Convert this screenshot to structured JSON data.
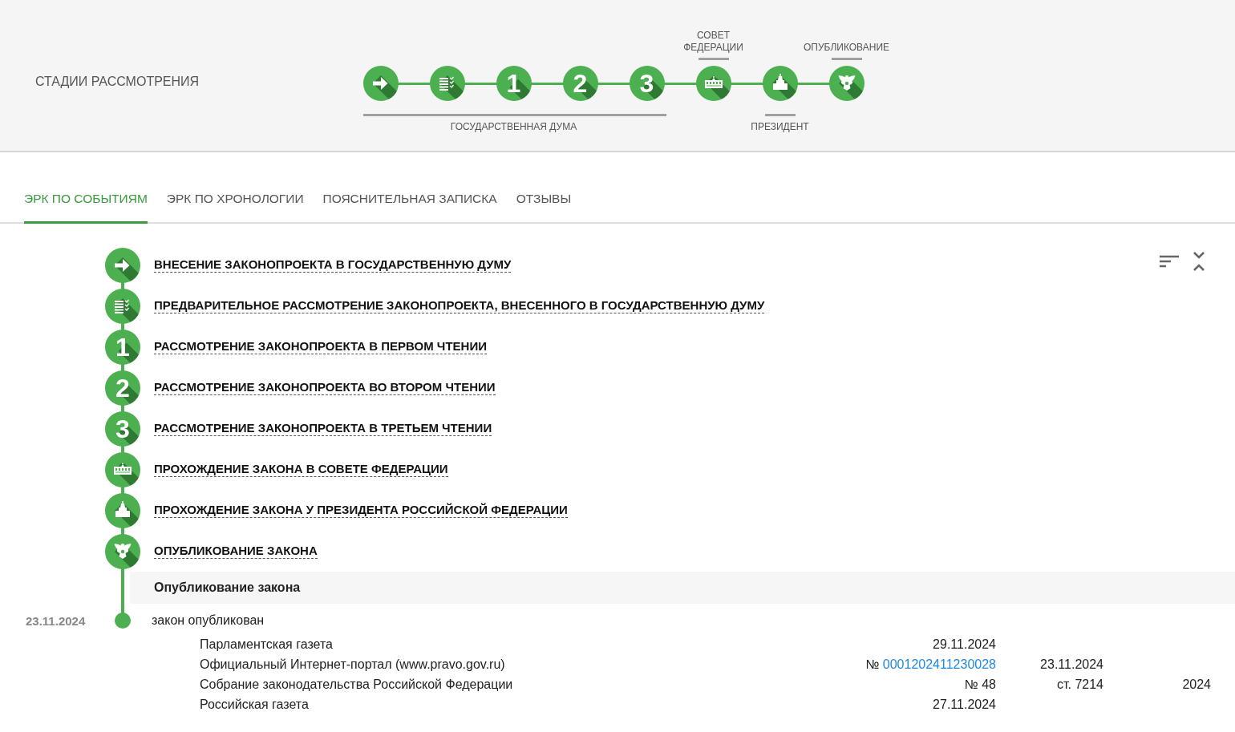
{
  "header": {
    "title": "СТАДИИ РАССМОТРЕНИЯ"
  },
  "stage_groups": [
    {
      "label": "ГОСУДАРСТВЕННАЯ ДУМА",
      "kind": "below",
      "stages": [
        {
          "kind": "arrow"
        },
        {
          "kind": "list"
        },
        {
          "kind": "number",
          "number": "1"
        },
        {
          "kind": "number",
          "number": "2"
        },
        {
          "kind": "number",
          "number": "3"
        }
      ]
    },
    {
      "label": "СОВЕТ ФЕДЕРАЦИИ",
      "kind": "above",
      "stages": [
        {
          "kind": "building"
        }
      ]
    },
    {
      "label": "ПРЕЗИДЕНТ",
      "kind": "below",
      "stages": [
        {
          "kind": "tower"
        }
      ]
    },
    {
      "label": "ОПУБЛИКОВАНИЕ",
      "kind": "above",
      "stages": [
        {
          "kind": "emblem"
        }
      ]
    }
  ],
  "tabs": [
    {
      "label": "ЭРК ПО СОБЫТИЯМ",
      "selected": true
    },
    {
      "label": "ЭРК ПО ХРОНОЛОГИИ",
      "selected": false
    },
    {
      "label": "ПОЯСНИТЕЛЬНАЯ ЗАПИСКА",
      "selected": false
    },
    {
      "label": "ОТЗЫВЫ",
      "selected": false
    }
  ],
  "events": [
    {
      "kind": "arrow",
      "title": "ВНЕСЕНИЕ ЗАКОНОПРОЕКТА В ГОСУДАРСТВЕННУЮ ДУМУ"
    },
    {
      "kind": "list",
      "title": "ПРЕДВАРИТЕЛЬНОЕ РАССМОТРЕНИЕ ЗАКОНОПРОЕКТА, ВНЕСЕННОГО В ГОСУДАРСТВЕННУЮ ДУМУ"
    },
    {
      "kind": "number",
      "number": "1",
      "title": "РАССМОТРЕНИЕ ЗАКОНОПРОЕКТА В ПЕРВОМ ЧТЕНИИ"
    },
    {
      "kind": "number",
      "number": "2",
      "title": "РАССМОТРЕНИЕ ЗАКОНОПРОЕКТА ВО ВТОРОМ ЧТЕНИИ"
    },
    {
      "kind": "number",
      "number": "3",
      "title": "РАССМОТРЕНИЕ ЗАКОНОПРОЕКТА В ТРЕТЬЕМ ЧТЕНИИ"
    },
    {
      "kind": "building",
      "title": "ПРОХОЖДЕНИЕ ЗАКОНА В СОВЕТЕ ФЕДЕРАЦИИ"
    },
    {
      "kind": "tower",
      "title": "ПРОХОЖДЕНИЕ ЗАКОНА У ПРЕЗИДЕНТА РОССИЙСКОЙ ФЕДЕРАЦИИ"
    },
    {
      "kind": "emblem",
      "title": "ОПУБЛИКОВАНИЕ ЗАКОНА"
    }
  ],
  "publication": {
    "heading": "Опубликование закона",
    "date": "23.11.2024",
    "status": "закон опубликован",
    "sources": [
      {
        "name": "Парламентская газета",
        "column_2": {
          "text": "29.11.2024"
        }
      },
      {
        "name": "Официальный Интернет-портал (www.pravo.gov.ru)",
        "column_2": {
          "text": "№",
          "link": "0001202411230028"
        },
        "column_3": "23.11.2024"
      },
      {
        "name": "Собрание законодательства Российской Федерации",
        "column_2": {
          "text": "№ 48"
        },
        "column_3": "ст. 7214",
        "column_4": "2024"
      },
      {
        "name": "Российская газета",
        "column_2": {
          "text": "27.11.2024"
        }
      }
    ]
  }
}
